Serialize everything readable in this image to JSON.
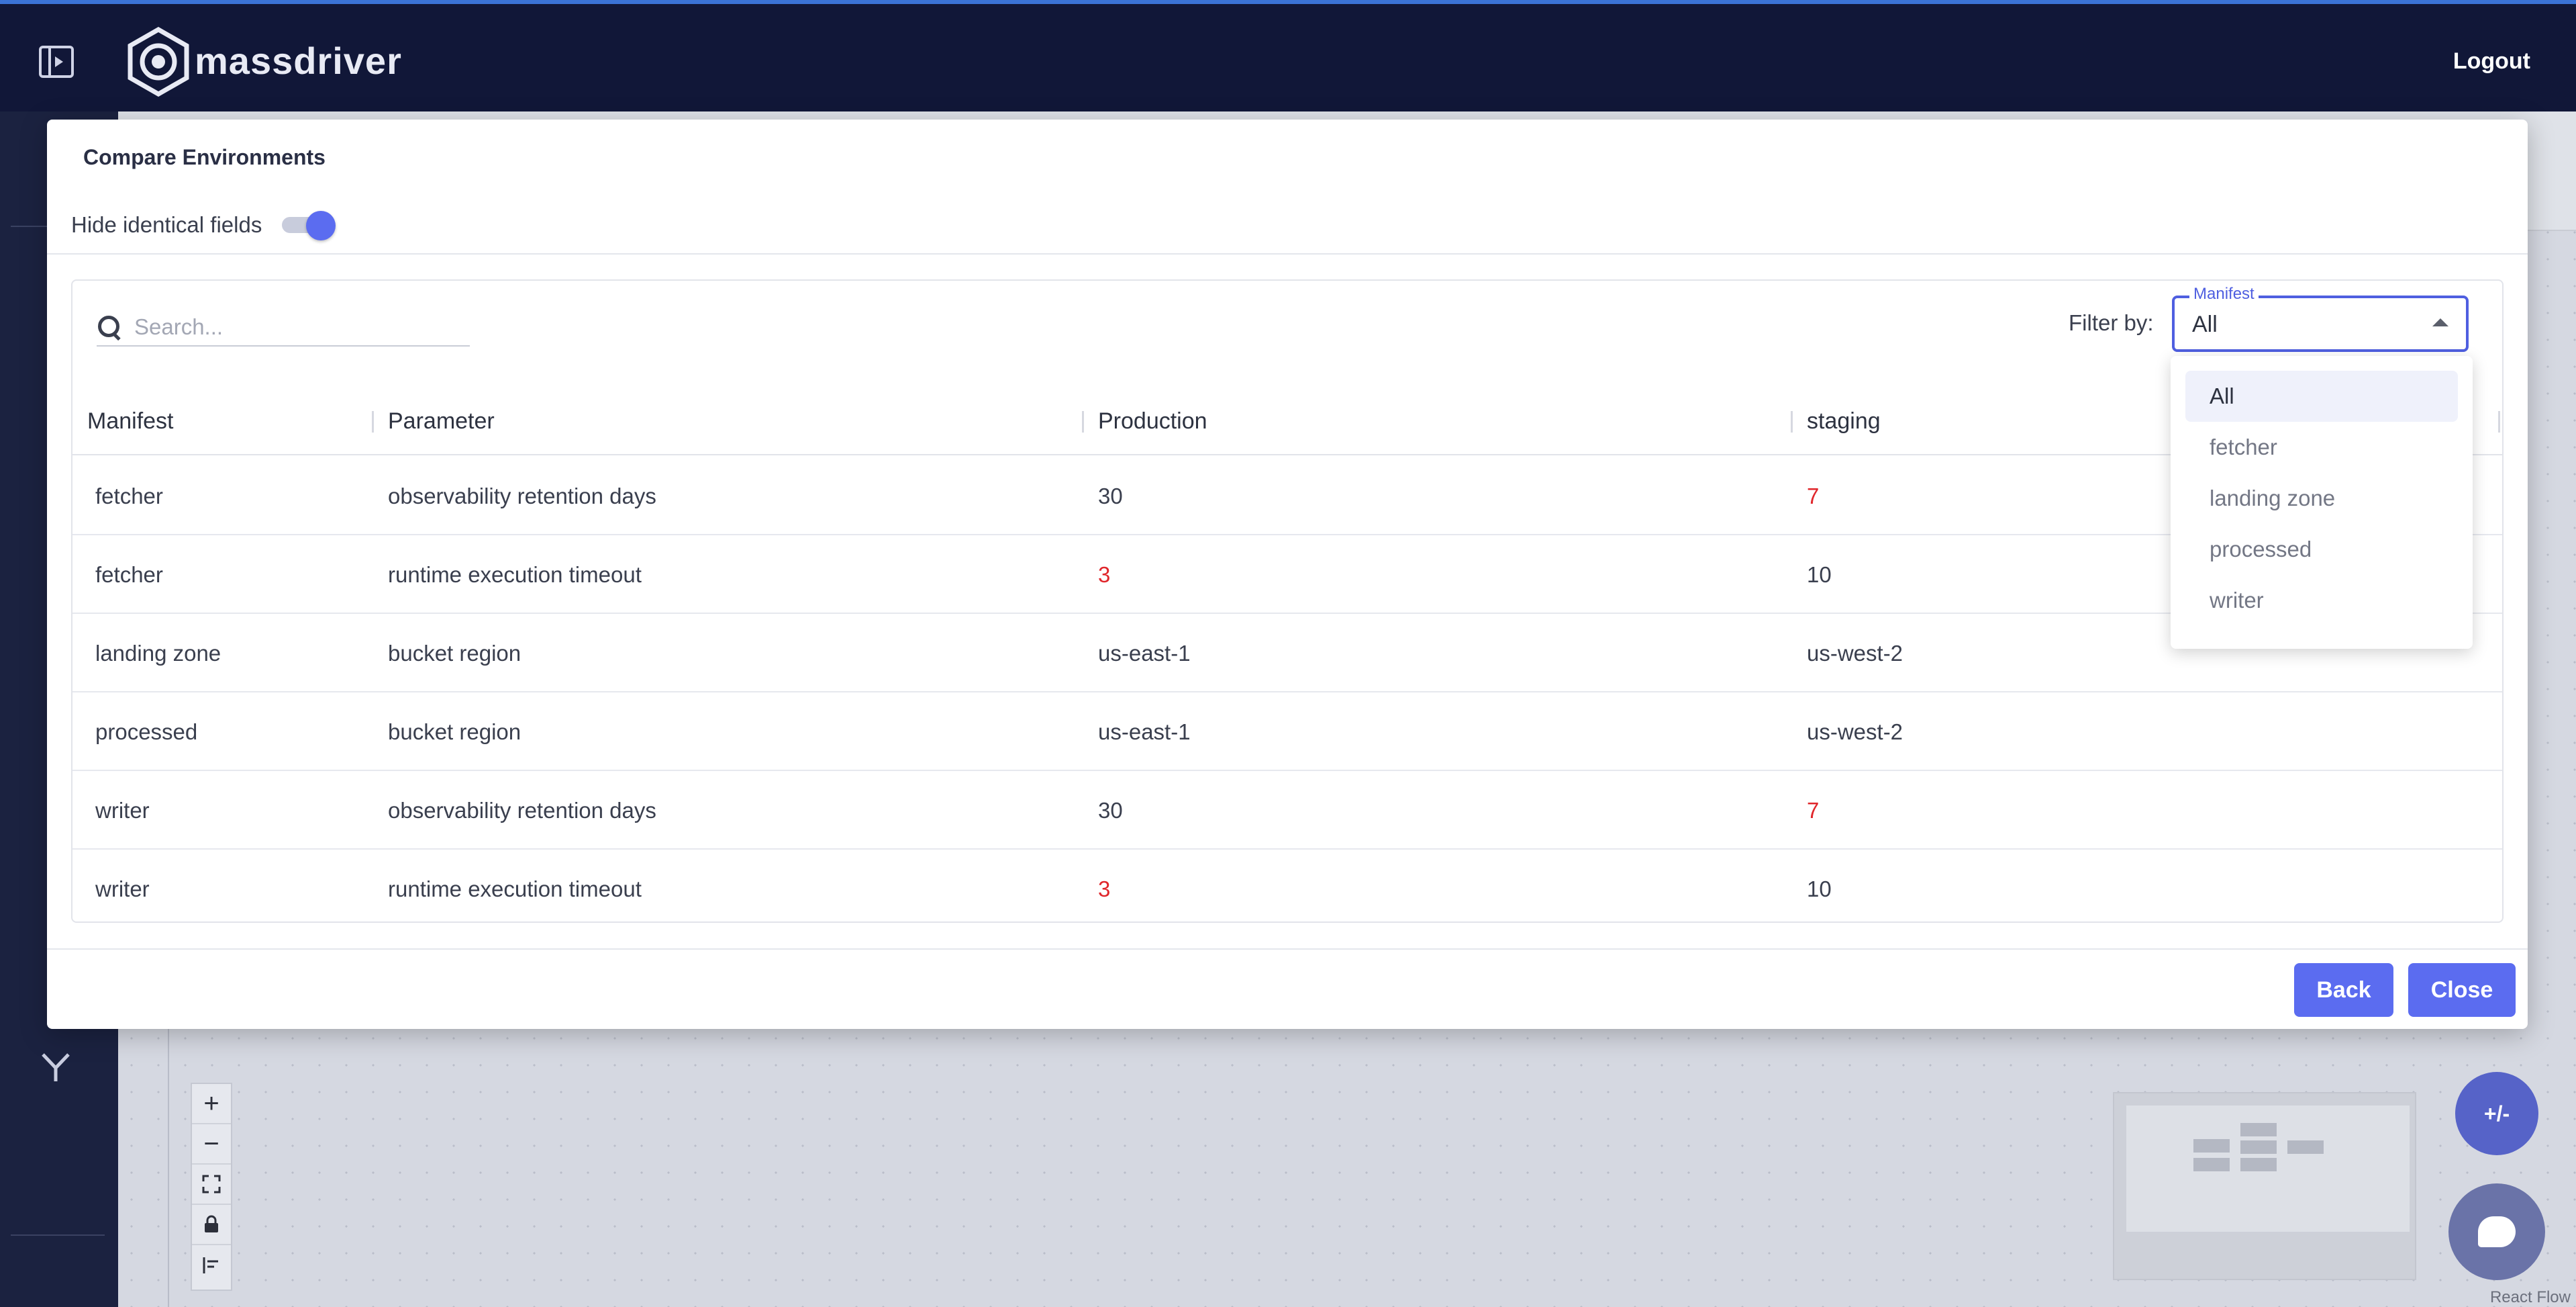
{
  "app": {
    "brand": "massdriver",
    "logout_label": "Logout"
  },
  "modal": {
    "title": "Compare Environments",
    "hide_identical_label": "Hide identical fields",
    "hide_identical_on": true,
    "search": {
      "placeholder": "Search...",
      "value": ""
    },
    "filter": {
      "label": "Filter by:",
      "field_label": "Manifest",
      "selected": "All",
      "options": [
        "All",
        "fetcher",
        "landing zone",
        "processed",
        "writer"
      ]
    },
    "table": {
      "columns": [
        "Manifest",
        "Parameter",
        "Production",
        "staging"
      ],
      "rows": [
        {
          "manifest": "fetcher",
          "parameter": "observability retention days",
          "production": "30",
          "staging": "7",
          "diff": "staging"
        },
        {
          "manifest": "fetcher",
          "parameter": "runtime execution timeout",
          "production": "3",
          "staging": "10",
          "diff": "production"
        },
        {
          "manifest": "landing zone",
          "parameter": "bucket region",
          "production": "us-east-1",
          "staging": "us-west-2",
          "diff": ""
        },
        {
          "manifest": "processed",
          "parameter": "bucket region",
          "production": "us-east-1",
          "staging": "us-west-2",
          "diff": ""
        },
        {
          "manifest": "writer",
          "parameter": "observability retention days",
          "production": "30",
          "staging": "7",
          "diff": "staging"
        },
        {
          "manifest": "writer",
          "parameter": "runtime execution timeout",
          "production": "3",
          "staging": "10",
          "diff": "production"
        }
      ]
    },
    "back_label": "Back",
    "close_label": "Close"
  },
  "canvas": {
    "diff_fab_label": "+/-",
    "attribution": "React Flow",
    "controls": {
      "zoom_in": "+",
      "zoom_out": "−"
    }
  },
  "colors": {
    "accent": "#5b6cf0",
    "diff": "#e0262b",
    "topbar": "#111738"
  }
}
